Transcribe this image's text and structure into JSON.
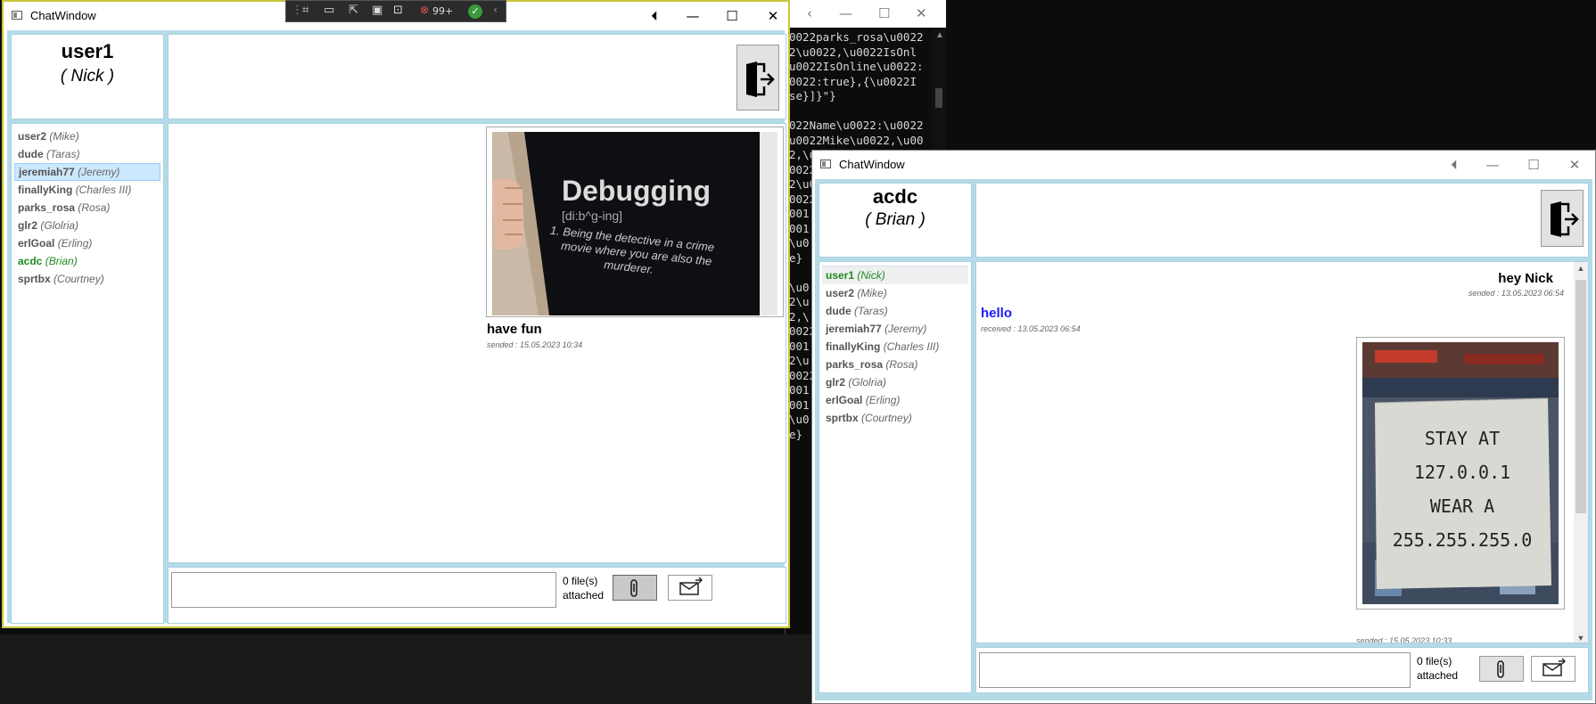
{
  "console": {
    "controls": [
      "‹",
      "—",
      "☐",
      "✕"
    ],
    "lines": [
      "0022parks_rosa\\u0022",
      "2\\u0022,\\u0022IsOnl",
      "u0022IsOnline\\u0022:",
      "0022:true},{\\u0022I",
      "se}]}\"}",
      "",
      "022Name\\u0022:\\u0022",
      "u0022Mike\\u0022,\\u00",
      "2,\\u0022IsOnline\\u0",
      "0022:true},{\\u0022",
      "2\\u0022,\\u0022Name",
      "0022IsOnline\\u0022",
      "001",
      "001",
      "\\u0",
      "e}",
      "",
      "\\u0",
      "2\\u",
      "2,\\",
      "0022",
      "001",
      "2\\u",
      "0022",
      "001",
      "001",
      "\\u0",
      "e}"
    ]
  },
  "toolbar": {
    "badge": "99+"
  },
  "window1": {
    "title": "ChatWindow",
    "user_name": "user1",
    "user_nick": "( Nick )",
    "users": [
      {
        "login": "user2",
        "name": "(Mike)"
      },
      {
        "login": "dude",
        "name": "(Taras)"
      },
      {
        "login": "jeremiah77",
        "name": "(Jeremy)"
      },
      {
        "login": "finallyKing",
        "name": "(Charles III)"
      },
      {
        "login": "parks_rosa",
        "name": "(Rosa)"
      },
      {
        "login": "glr2",
        "name": "(Glolria)"
      },
      {
        "login": "erlGoal",
        "name": "(Erling)"
      },
      {
        "login": "acdc",
        "name": "(Brian)"
      },
      {
        "login": "sprtbx",
        "name": "(Courtney)"
      }
    ],
    "message": {
      "image": {
        "title": "Debugging",
        "phonetic": "[di:b^g-ing]",
        "definition_1": "1. Being the detective in a crime",
        "definition_2": "movie where you are also the",
        "definition_3": "murderer."
      },
      "text": "have fun",
      "meta": "sended :  15.05.2023 10:34"
    },
    "files_line1": "0 file(s)",
    "files_line2": "attached"
  },
  "window2": {
    "title": "ChatWindow",
    "user_name": "acdc",
    "user_nick": "( Brian )",
    "users": [
      {
        "login": "user1",
        "name": "(Nick)"
      },
      {
        "login": "user2",
        "name": "(Mike)"
      },
      {
        "login": "dude",
        "name": "(Taras)"
      },
      {
        "login": "jeremiah77",
        "name": "(Jeremy)"
      },
      {
        "login": "finallyKing",
        "name": "(Charles III)"
      },
      {
        "login": "parks_rosa",
        "name": "(Rosa)"
      },
      {
        "login": "glr2",
        "name": "(Glolria)"
      },
      {
        "login": "erlGoal",
        "name": "(Erling)"
      },
      {
        "login": "sprtbx",
        "name": "(Courtney)"
      }
    ],
    "messages": {
      "sent_text": "hey Nick",
      "sent_meta": "sended :  13.05.2023 06:54",
      "recv_text": "hello",
      "recv_meta": "received :  13.05.2023 06:54",
      "image": {
        "line1": "STAY AT",
        "line2": "127.0.0.1",
        "line3": "WEAR A",
        "line4": "255.255.255.0"
      },
      "img_meta": "sended :  15.05.2023 10:33"
    },
    "files_line1": "0 file(s)",
    "files_line2": "attached"
  }
}
